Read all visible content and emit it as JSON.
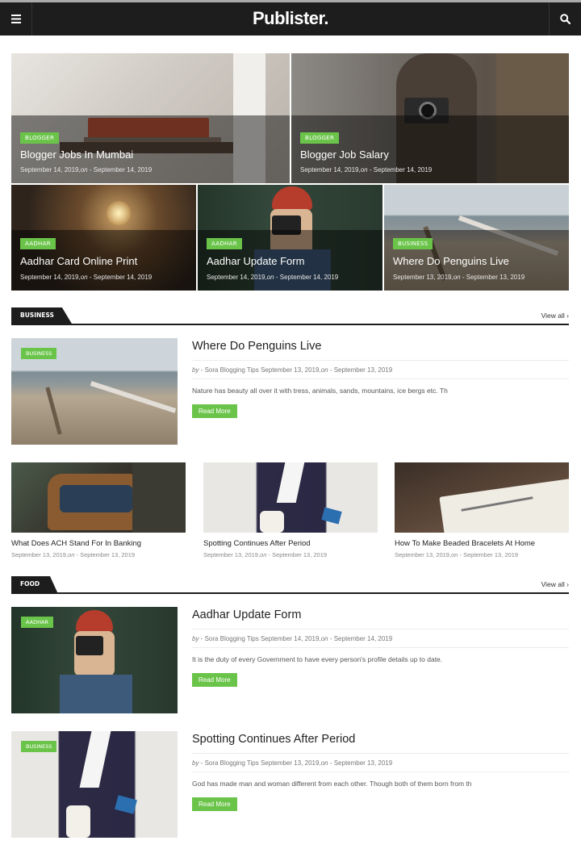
{
  "header": {
    "logo": "Publister.",
    "menu_icon": "hamburger-icon",
    "search_icon": "search-icon"
  },
  "colors": {
    "accent": "#6bc44a",
    "dark": "#1d1d1d"
  },
  "featured": [
    {
      "tag": "BLOGGER",
      "title": "Blogger Jobs In Mumbai",
      "date": "September 14, 2019",
      "on": "on",
      "date2": "September 14, 2019"
    },
    {
      "tag": "BLOGGER",
      "title": "Blogger Job Salary",
      "date": "September 14, 2019",
      "on": "on",
      "date2": "September 14, 2019"
    },
    {
      "tag": "AADHAR",
      "title": "Aadhar Card Online Print",
      "date": "September 14, 2019",
      "on": "on",
      "date2": "September 14, 2019"
    },
    {
      "tag": "AADHAR",
      "title": "Aadhar Update Form",
      "date": "September 14, 2019",
      "on": "on",
      "date2": "September 14, 2019"
    },
    {
      "tag": "BUSINESS",
      "title": "Where Do Penguins Live",
      "date": "September 13, 2019",
      "on": "on",
      "date2": "September 13, 2019"
    }
  ],
  "business": {
    "label": "BUSINESS",
    "view_all": "View all",
    "post": {
      "tag": "BUSINESS",
      "title": "Where Do Penguins Live",
      "by": "by",
      "author": "Sora Blogging Tips",
      "date": "September 13, 2019",
      "on": "on",
      "date2": "September 13, 2019",
      "excerpt": "Nature has beauty all over it with tress, animals, sands, mountains, ice bergs etc. Th",
      "read_more": "Read More"
    },
    "grid": [
      {
        "title": "What Does ACH Stand For In Banking",
        "date": "September 13, 2019",
        "on": "on",
        "date2": "September 13, 2019"
      },
      {
        "title": "Spotting Continues After Period",
        "date": "September 13, 2019",
        "on": "on",
        "date2": "September 13, 2019"
      },
      {
        "title": "How To Make Beaded Bracelets At Home",
        "date": "September 13, 2019",
        "on": "on",
        "date2": "September 13, 2019"
      }
    ]
  },
  "food": {
    "label": "FOOD",
    "view_all": "View all",
    "posts": [
      {
        "tag": "AADHAR",
        "title": "Aadhar Update Form",
        "by": "by",
        "author": "Sora Blogging Tips",
        "date": "September 14, 2019",
        "on": "on",
        "date2": "September 14, 2019",
        "excerpt": "It is the duty of every Government to have every person's profile details up to date.",
        "read_more": "Read More"
      },
      {
        "tag": "BUSINESS",
        "title": "Spotting Continues After Period",
        "by": "by",
        "author": "Sora Blogging Tips",
        "date": "September 13, 2019",
        "on": "on",
        "date2": "September 13, 2019",
        "excerpt": "God has made man and woman different from each other. Though both of them born from th",
        "read_more": "Read More"
      }
    ]
  }
}
